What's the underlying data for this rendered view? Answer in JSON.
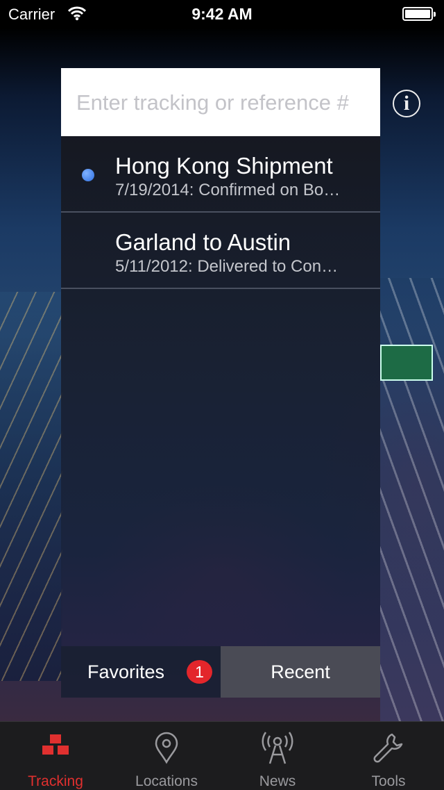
{
  "status_bar": {
    "carrier": "Carrier",
    "time": "9:42 AM"
  },
  "search": {
    "placeholder": "Enter tracking or reference #",
    "value": ""
  },
  "shipments": [
    {
      "title": "Hong Kong Shipment",
      "subtitle": "7/19/2014: Confirmed on Bo…",
      "unread": true
    },
    {
      "title": "Garland to Austin",
      "subtitle": "5/11/2012: Delivered to Con…",
      "unread": false
    }
  ],
  "segments": {
    "favorites_label": "Favorites",
    "favorites_badge": "1",
    "recent_label": "Recent",
    "selected": "Recent"
  },
  "tabs": [
    {
      "label": "Tracking",
      "icon": "boxes-icon",
      "active": true
    },
    {
      "label": "Locations",
      "icon": "map-pin-icon",
      "active": false
    },
    {
      "label": "News",
      "icon": "broadcast-tower-icon",
      "active": false
    },
    {
      "label": "Tools",
      "icon": "wrench-icon",
      "active": false
    }
  ],
  "colors": {
    "accent": "#e0302f",
    "badge": "#e3262b",
    "unread_dot": "#2f6fe0"
  }
}
